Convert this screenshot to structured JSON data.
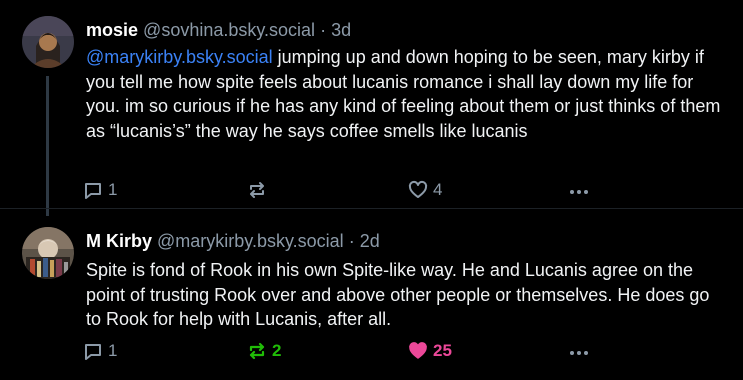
{
  "posts": [
    {
      "display_name": "mosie",
      "handle": "@sovhina.bsky.social",
      "separator": "·",
      "time": "3d",
      "mention": "@marykirby.bsky.social",
      "text": " jumping up and down hoping to be seen, mary kirby if you tell me how spite feels about lucanis romance i shall lay down my life for you. im so curious if he has any kind of feeling about them or just thinks of them as “lucanis’s”  the way he says coffee smells like lucanis",
      "reply_count": "1",
      "repost_count": "",
      "like_count": "4"
    },
    {
      "display_name": "M Kirby",
      "handle": "@marykirby.bsky.social",
      "separator": "·",
      "time": "2d",
      "text": "Spite is fond of Rook in his own Spite-like way. He and Lucanis agree on the point of trusting Rook over and above other people or themselves. He does go to Rook for help with Lucanis, after all.",
      "reply_count": "1",
      "repost_count": "2",
      "like_count": "25"
    }
  ],
  "icons": {
    "reply": "speech-bubble-icon",
    "repost": "repost-arrows-icon",
    "like": "heart-icon",
    "more": "ellipsis-icon"
  },
  "colors": {
    "background": "#000000",
    "text": "#f1f3f5",
    "muted": "#8c9aa8",
    "mention": "#3b82f6",
    "repost_active": "#20bc07",
    "like_active": "#ec4899",
    "thread_line": "#2e3944"
  }
}
